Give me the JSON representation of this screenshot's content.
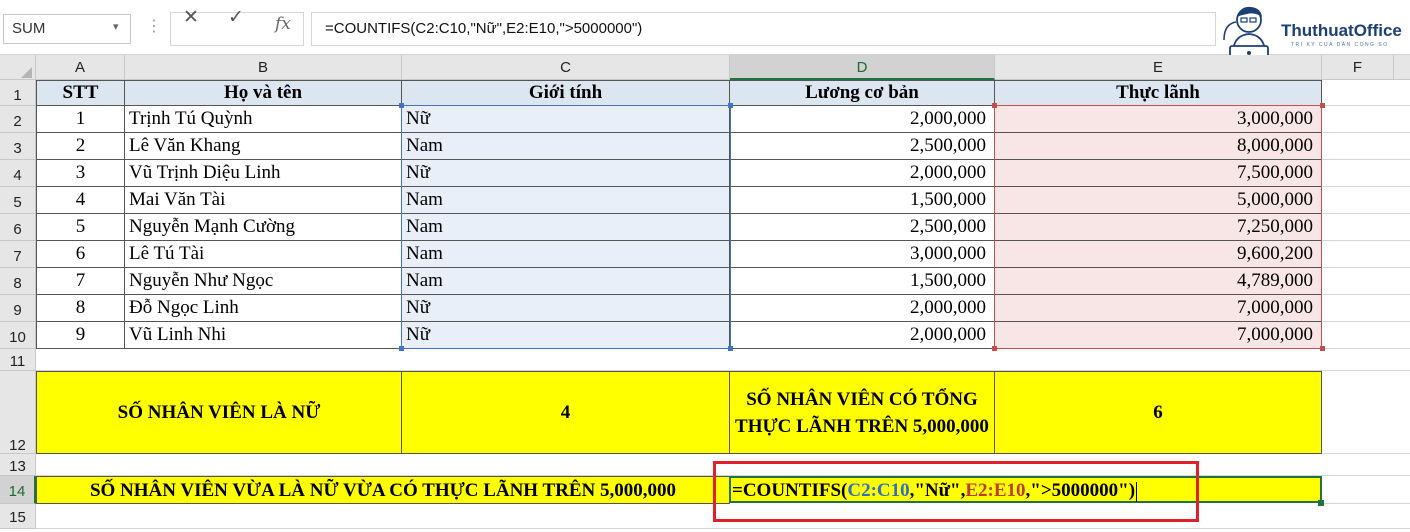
{
  "formula_bar": {
    "name_box": "SUM",
    "cancel_icon": "✕",
    "enter_icon": "✓",
    "fx_label": "fx",
    "formula": "=COUNTIFS(C2:C10,\"Nữ\",E2:E10,\">5000000\")"
  },
  "logo": {
    "text": "ThuthuatOffice",
    "tagline": "TRI KY CUA DAN CONG SO"
  },
  "columns": [
    "A",
    "B",
    "C",
    "D",
    "E",
    "F"
  ],
  "rows": [
    "1",
    "2",
    "3",
    "4",
    "5",
    "6",
    "7",
    "8",
    "9",
    "10",
    "11",
    "12",
    "13",
    "14",
    "15"
  ],
  "table": {
    "headers": [
      "STT",
      "Họ và tên",
      "Giới tính",
      "Lương cơ bản",
      "Thực lãnh"
    ],
    "records": [
      {
        "stt": "1",
        "name": "Trịnh Tú Quỳnh",
        "gender": "Nữ",
        "salary": "2,000,000",
        "net": "3,000,000"
      },
      {
        "stt": "2",
        "name": "Lê Văn Khang",
        "gender": "Nam",
        "salary": "2,500,000",
        "net": "8,000,000"
      },
      {
        "stt": "3",
        "name": "Vũ Trịnh Diệu Linh",
        "gender": "Nữ",
        "salary": "2,000,000",
        "net": "7,500,000"
      },
      {
        "stt": "4",
        "name": "Mai Văn Tài",
        "gender": "Nam",
        "salary": "1,500,000",
        "net": "5,000,000"
      },
      {
        "stt": "5",
        "name": "Nguyễn Mạnh Cường",
        "gender": "Nam",
        "salary": "2,500,000",
        "net": "7,250,000"
      },
      {
        "stt": "6",
        "name": "Lê Tú Tài",
        "gender": "Nam",
        "salary": "3,000,000",
        "net": "9,600,200"
      },
      {
        "stt": "7",
        "name": "Nguyễn Như Ngọc",
        "gender": "Nam",
        "salary": "1,500,000",
        "net": "4,789,000"
      },
      {
        "stt": "8",
        "name": "Đỗ Ngọc Linh",
        "gender": "Nữ",
        "salary": "2,000,000",
        "net": "7,000,000"
      },
      {
        "stt": "9",
        "name": "Vũ Linh Nhi",
        "gender": "Nữ",
        "salary": "2,000,000",
        "net": "7,000,000"
      }
    ]
  },
  "summary": {
    "female_label": "SỐ NHÂN VIÊN LÀ NỮ",
    "female_count": "4",
    "net_label": "SỐ NHÂN VIÊN CÓ TỔNG THỰC LÃNH TRÊN 5,000,000",
    "net_count": "6"
  },
  "row14": {
    "label": "SỐ NHÂN VIÊN VỪA LÀ NỮ VỪA CÓ THỰC LÃNH TRÊN 5,000,000",
    "formula_parts": [
      "=COUNTIFS(",
      "C2:C10",
      ",\"Nữ\",",
      "E2:E10",
      ",\">5000000\")"
    ]
  },
  "colors": {
    "ref_blue": "#2f6fc9",
    "ref_red": "#c0392b",
    "highlight_yellow": "#ffff00",
    "callout_red": "#e0202a",
    "header_fill": "#dce6f1"
  }
}
